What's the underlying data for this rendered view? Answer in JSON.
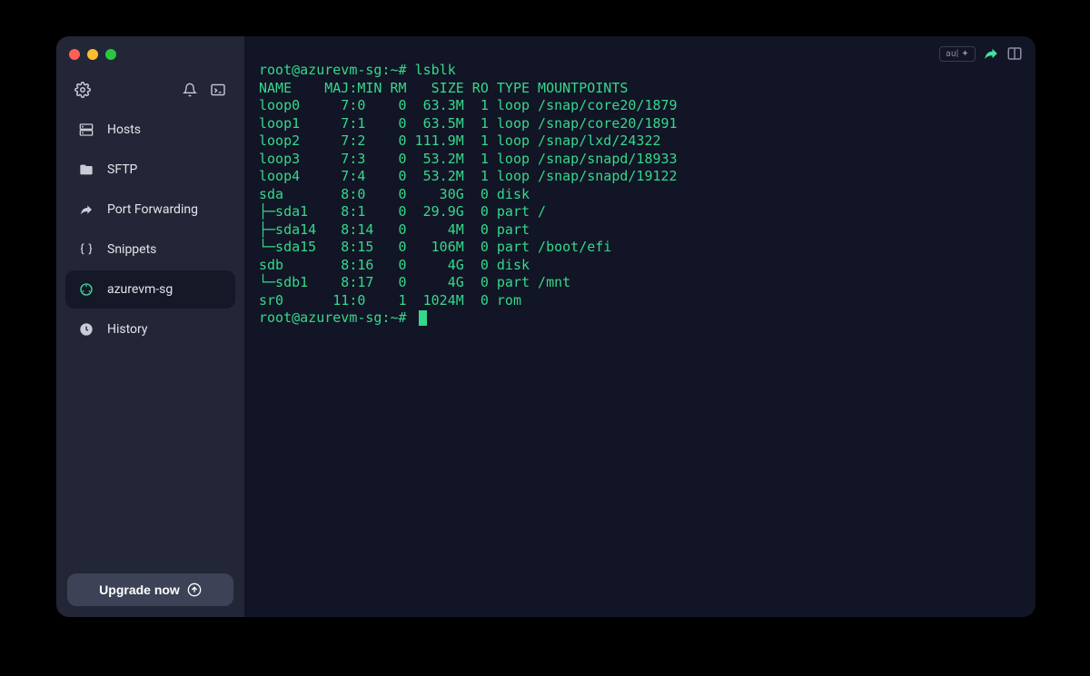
{
  "sidebar": {
    "items": [
      {
        "label": "Hosts"
      },
      {
        "label": "SFTP"
      },
      {
        "label": "Port Forwarding"
      },
      {
        "label": "Snippets"
      },
      {
        "label": "azurevm-sg"
      },
      {
        "label": "History"
      }
    ],
    "upgrade_label": "Upgrade now"
  },
  "badge": "au| ✦",
  "terminal": {
    "prompt1": "root@azurevm-sg:~# lsblk",
    "header": "NAME    MAJ:MIN RM   SIZE RO TYPE MOUNTPOINTS",
    "rows": [
      "loop0     7:0    0  63.3M  1 loop /snap/core20/1879",
      "loop1     7:1    0  63.5M  1 loop /snap/core20/1891",
      "loop2     7:2    0 111.9M  1 loop /snap/lxd/24322",
      "loop3     7:3    0  53.2M  1 loop /snap/snapd/18933",
      "loop4     7:4    0  53.2M  1 loop /snap/snapd/19122",
      "sda       8:0    0    30G  0 disk ",
      "├─sda1    8:1    0  29.9G  0 part /",
      "├─sda14   8:14   0     4M  0 part ",
      "└─sda15   8:15   0   106M  0 part /boot/efi",
      "sdb       8:16   0     4G  0 disk ",
      "└─sdb1    8:17   0     4G  0 part /mnt",
      "sr0      11:0    1  1024M  0 rom  "
    ],
    "prompt2": "root@azurevm-sg:~# "
  }
}
